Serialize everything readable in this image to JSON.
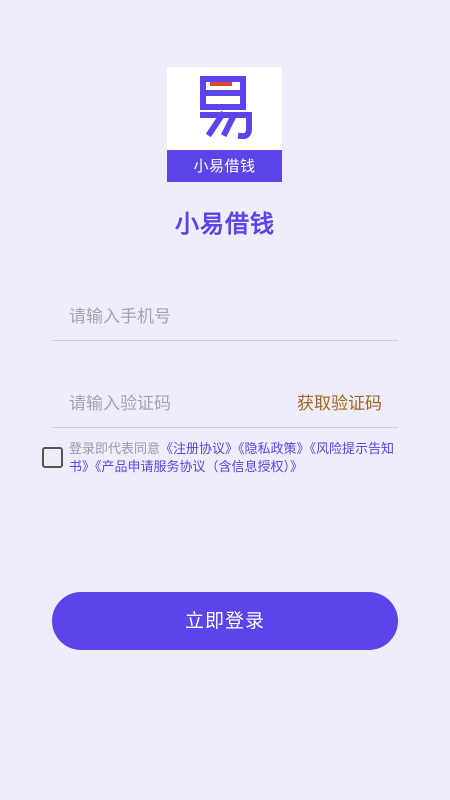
{
  "logo": {
    "icon": "yi-character-logo-icon",
    "strip_text": "小易借钱"
  },
  "app_name": "小易借钱",
  "phone_field": {
    "placeholder": "请输入手机号",
    "value": ""
  },
  "code_field": {
    "placeholder": "请输入验证码",
    "value": "",
    "get_code_label": "获取验证码"
  },
  "agreement": {
    "checked": false,
    "prefix": "登录即代表同意",
    "links": [
      "《注册协议》",
      "《隐私政策》",
      "《风险提示告知书》",
      "《产品申请服务协议（含信息授权）》"
    ]
  },
  "login_button": {
    "label": "立即登录"
  },
  "colors": {
    "background": "#efedfb",
    "accent": "#5b44ea",
    "get_code": "#a3661a",
    "logo_bar": "#e0472c"
  }
}
